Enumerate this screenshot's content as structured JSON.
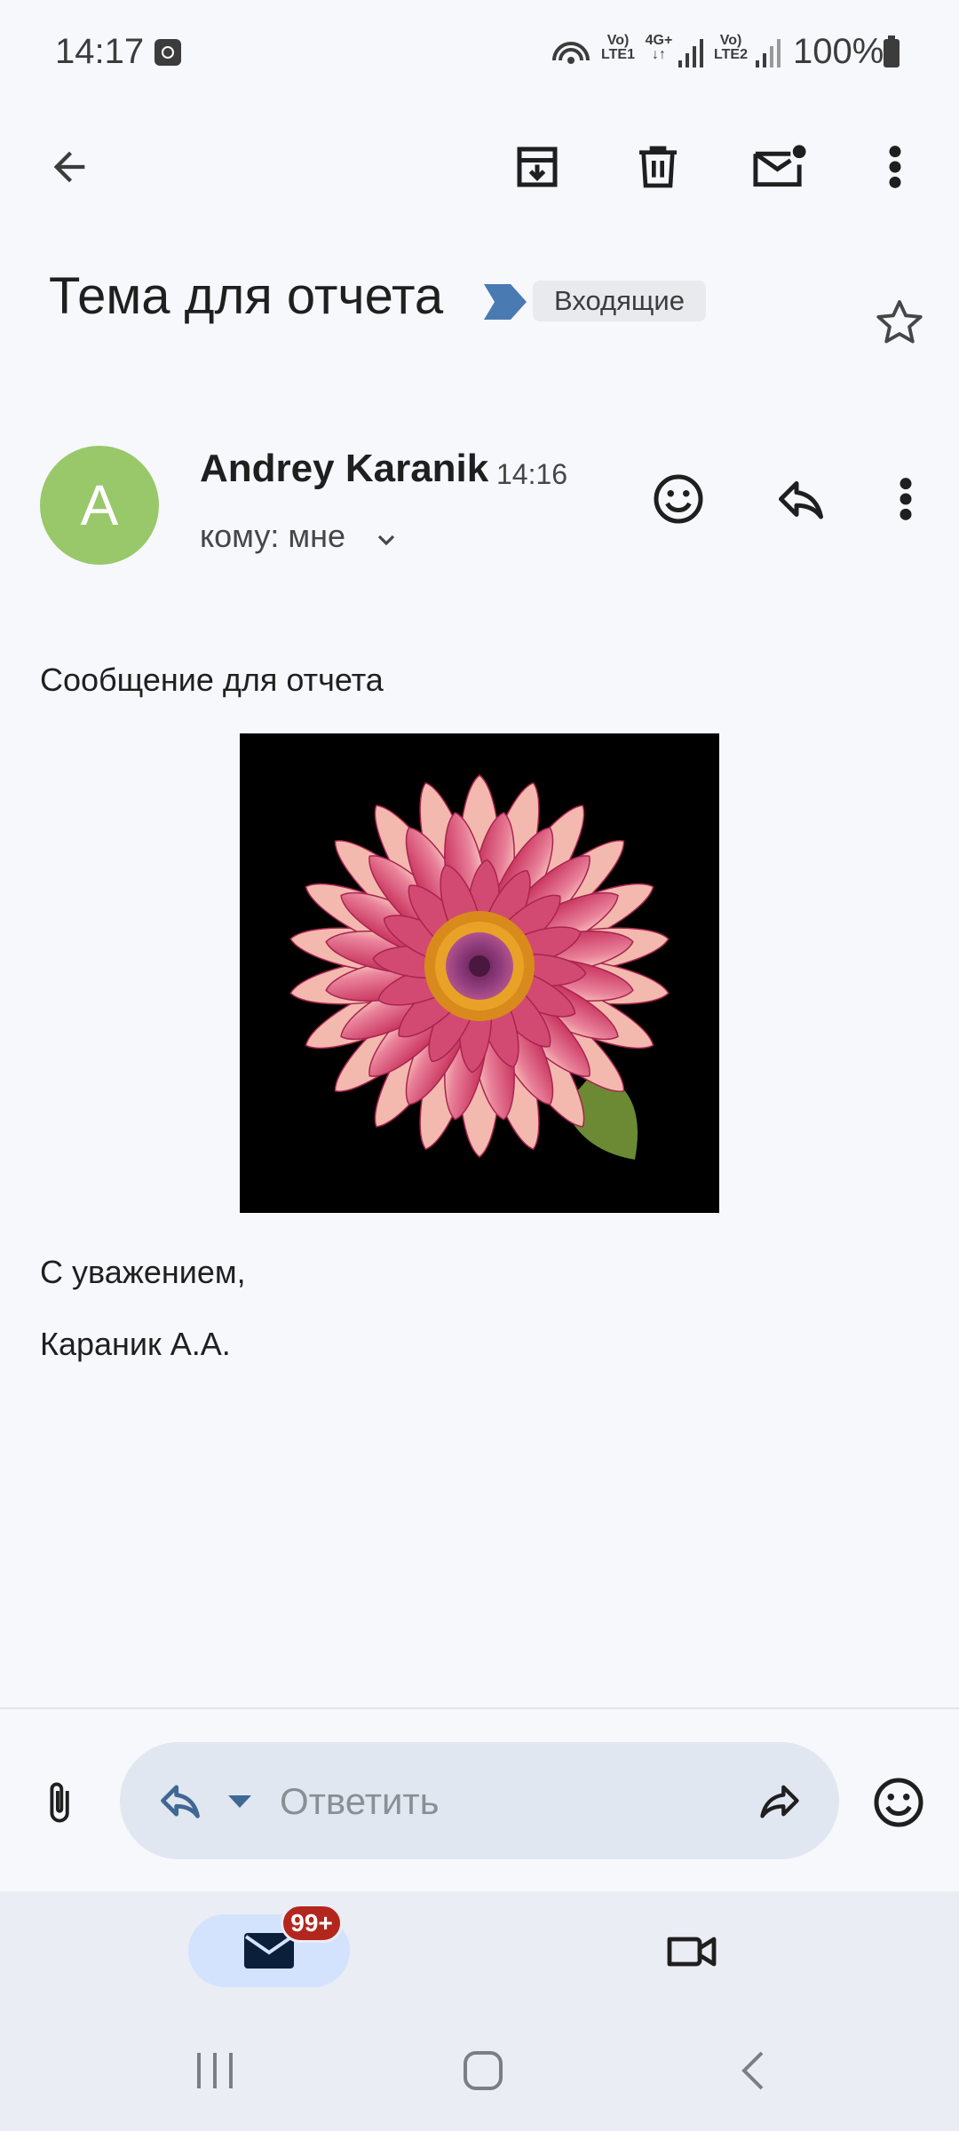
{
  "status_bar": {
    "time": "14:17",
    "net1_top": "Vo)",
    "net1_bottom": "LTE1",
    "net_type": "4G+",
    "net2_top": "Vo)",
    "net2_bottom": "LTE2",
    "battery": "100%"
  },
  "toolbar": {
    "back_icon": "arrow-left-icon",
    "archive_icon": "archive-icon",
    "delete_icon": "trash-icon",
    "mark_unread_icon": "mail-unread-icon",
    "more_icon": "more-vert-icon"
  },
  "email": {
    "subject": "Тема для отчета",
    "label": "Входящие",
    "sender_initial": "A",
    "sender_name": "Andrey Karanik",
    "time": "14:16",
    "recipient": "кому: мне",
    "body": "Сообщение для отчета",
    "closing": "С уважением,",
    "signature": "Караник А.А."
  },
  "reply_bar": {
    "placeholder": "Ответить"
  },
  "bottom_nav": {
    "mail_badge": "99+"
  },
  "colors": {
    "background": "#f6f8fc",
    "avatar": "#98c86a",
    "label_arrow": "#4a7ab2",
    "badge": "#b3261e",
    "reply_icon": "#3f6895",
    "mail_tab": "#d3e3fd"
  }
}
